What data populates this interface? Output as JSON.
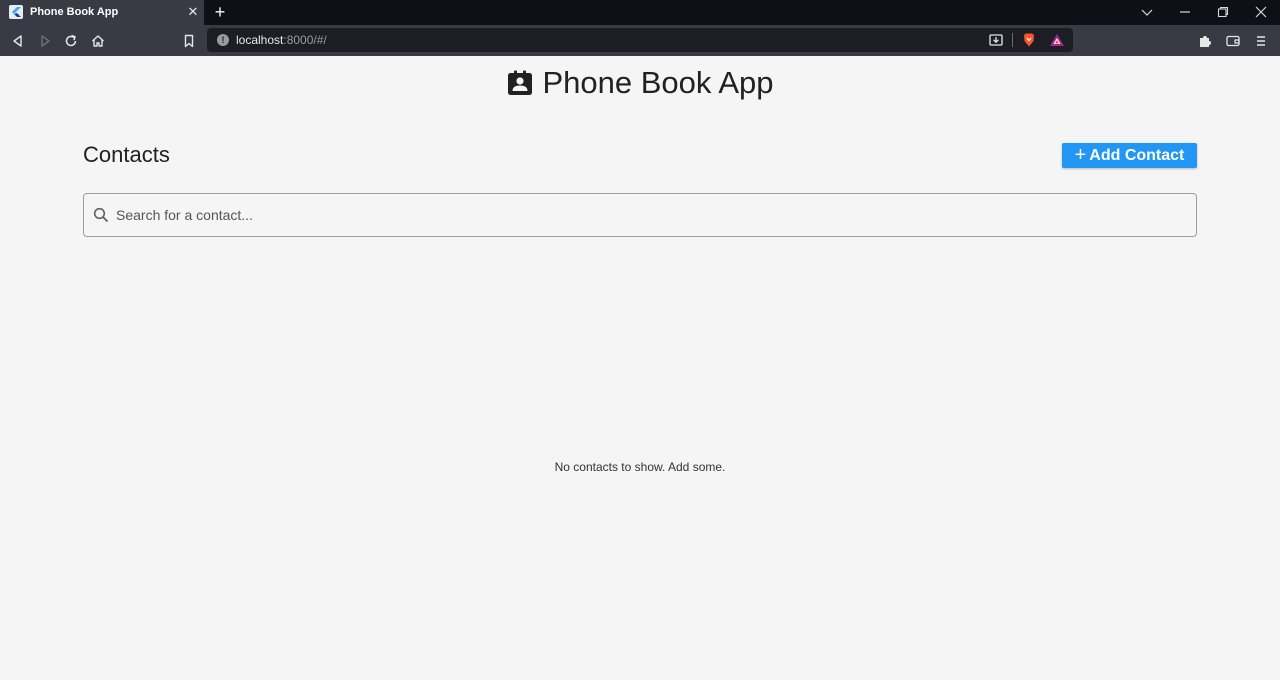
{
  "browser": {
    "tab_title": "Phone Book App",
    "url_host": "localhost",
    "url_rest": ":8000/#/"
  },
  "app": {
    "title": "Phone Book App",
    "contacts_heading": "Contacts",
    "add_button_plus": "+",
    "add_button_label": "Add Contact",
    "search_placeholder": "Search for a contact...",
    "empty_message": "No contacts to show. Add some."
  },
  "colors": {
    "accent": "#2196f3",
    "page_background": "#f5f5f5",
    "browser_chrome": "#3a3a45"
  }
}
